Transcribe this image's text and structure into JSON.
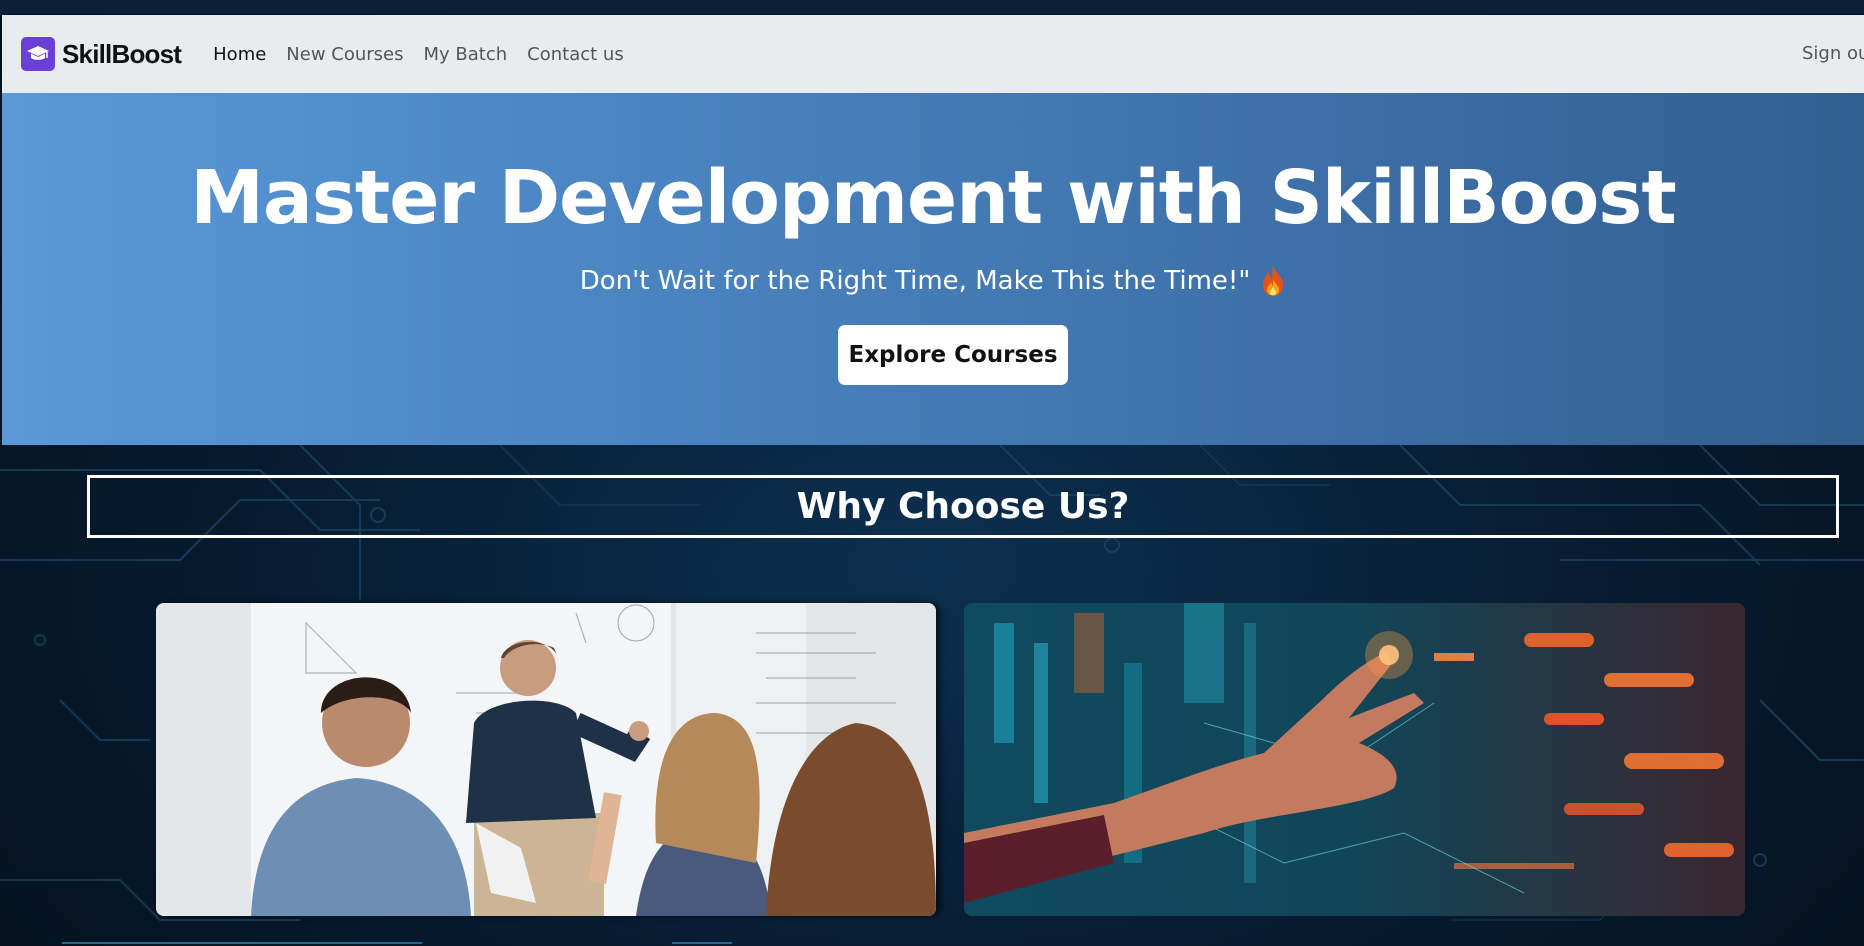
{
  "brand": {
    "name": "SkillBoost",
    "logo_icon": "graduation-cap-icon",
    "logo_color": "#6a3fd6"
  },
  "nav": {
    "links": [
      {
        "label": "Home",
        "active": true
      },
      {
        "label": "New Courses",
        "active": false
      },
      {
        "label": "My Batch",
        "active": false
      },
      {
        "label": "Contact us",
        "active": false
      }
    ],
    "signout_label": "Sign ou"
  },
  "hero": {
    "title": "Master Development with SkillBoost",
    "subtitle": "Don't Wait for the Right Time, Make This the Time!\"",
    "subtitle_icon": "fire-icon",
    "cta_label": "Explore Courses",
    "gradient": [
      "#5a98d8",
      "#31608f"
    ]
  },
  "why": {
    "title": "Why Choose Us?"
  },
  "images": [
    {
      "name": "classroom-teacher-image"
    },
    {
      "name": "digital-interface-hand-image"
    }
  ]
}
